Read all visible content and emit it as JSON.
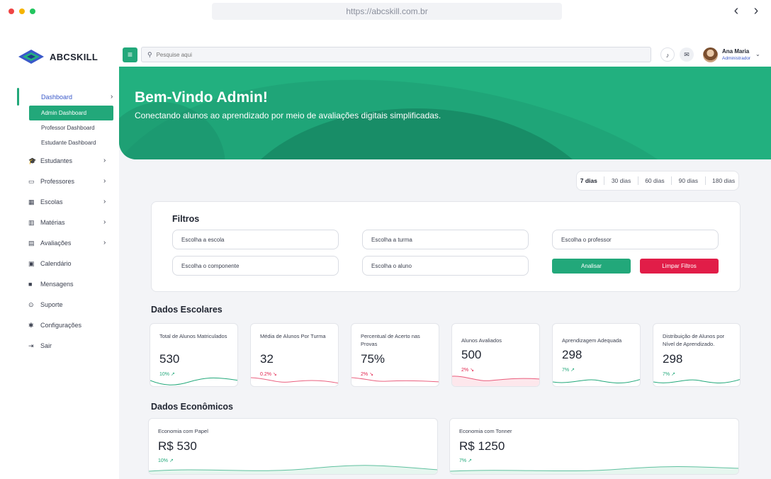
{
  "browser": {
    "url": "https://abcskill.com.br",
    "back": "‹",
    "forward": "›"
  },
  "brand": {
    "name": "ABCSKILL"
  },
  "sidebar": {
    "items": [
      {
        "label": "Dashboard",
        "icon": "dashboard-icon"
      },
      {
        "label": "Estudantes",
        "icon": "graduation-cap-icon"
      },
      {
        "label": "Professores",
        "icon": "chalkboard-icon"
      },
      {
        "label": "Escolas",
        "icon": "building-icon"
      },
      {
        "label": "Matérias",
        "icon": "books-icon"
      },
      {
        "label": "Avaliações",
        "icon": "clipboard-icon"
      },
      {
        "label": "Calendário",
        "icon": "calendar-icon"
      },
      {
        "label": "Mensagens",
        "icon": "chat-icon"
      },
      {
        "label": "Suporte",
        "icon": "support-icon"
      },
      {
        "label": "Configurações",
        "icon": "gear-icon"
      },
      {
        "label": "Sair",
        "icon": "logout-icon"
      }
    ],
    "dashboard_sub": [
      "Admin Dashboard",
      "Professor Dashboard",
      "Estudante Dashboard"
    ]
  },
  "topbar": {
    "search_placeholder": "Pesquise aqui",
    "user_name": "Ana Maria",
    "user_role": "Administrador"
  },
  "hero": {
    "title": "Bem-Vindo Admin!",
    "subtitle": "Conectando alunos ao aprendizado por meio de avaliações digitais simplificadas."
  },
  "range": {
    "options": [
      "7 dias",
      "30 dias",
      "60 dias",
      "90 dias",
      "180 dias"
    ],
    "selected": "7 dias"
  },
  "filters": {
    "title": "Filtros",
    "school": "Escolha a escola",
    "class": "Escolha a turma",
    "teacher": "Escolha o professor",
    "component": "Escolha o componente",
    "student": "Escolha o aluno",
    "analyze": "Analisar",
    "clear": "Limpar Filtros"
  },
  "school_data": {
    "title": "Dados Escolares",
    "cards": [
      {
        "label": "Total de Alunos Matriculados",
        "value": "530",
        "delta": "10%",
        "trend": "up"
      },
      {
        "label": "Média de Alunos Por Turma",
        "value": "32",
        "delta": "0.2%",
        "trend": "down"
      },
      {
        "label": "Percentual de Acerto nas Provas",
        "value": "75%",
        "delta": "2%",
        "trend": "down"
      },
      {
        "label": "Alunos Avaliados",
        "value": "500",
        "delta": "2%",
        "trend": "down"
      },
      {
        "label": "Aprendizagem Adequada",
        "value": "298",
        "delta": "7%",
        "trend": "up"
      },
      {
        "label": "Distribuição de Alunos por Nível de Aprendizado.",
        "value": "298",
        "delta": "7%",
        "trend": "up"
      }
    ]
  },
  "economic_data": {
    "title": "Dados Econômicos",
    "cards": [
      {
        "label": "Economia com Papel",
        "value": "R$ 530",
        "delta": "10%",
        "trend": "up"
      },
      {
        "label": "Economia com Tonner",
        "value": "R$ 1250",
        "delta": "7%",
        "trend": "up"
      }
    ]
  },
  "colors": {
    "accent": "#22a87a",
    "danger": "#e11d48",
    "link": "#3a59c9"
  }
}
